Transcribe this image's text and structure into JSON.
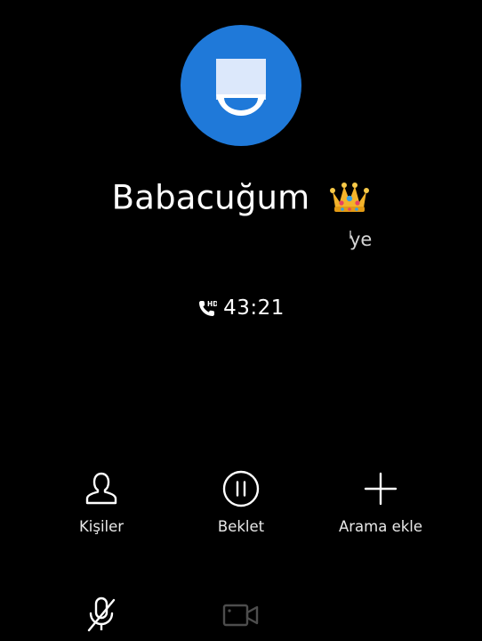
{
  "caller": {
    "name": "Babacuğum",
    "location": "ye"
  },
  "call": {
    "timer": "43:21"
  },
  "actions": {
    "contacts_label": "Kişiler",
    "hold_label": "Beklet",
    "add_call_label": "Arama ekle"
  },
  "icons": {
    "avatar": "person-placeholder-icon",
    "name_emoji": "crown-icon",
    "call_status": "hd-call-icon",
    "contacts": "contacts-icon",
    "hold": "pause-icon",
    "add_call": "plus-icon",
    "mute": "mute-icon",
    "video": "video-icon"
  },
  "colors": {
    "background": "#000000",
    "avatar_bg": "#1f79d9",
    "text": "#ffffff",
    "disabled_icon": "#4d4d4d",
    "crown_gold": "#f3b32a"
  }
}
